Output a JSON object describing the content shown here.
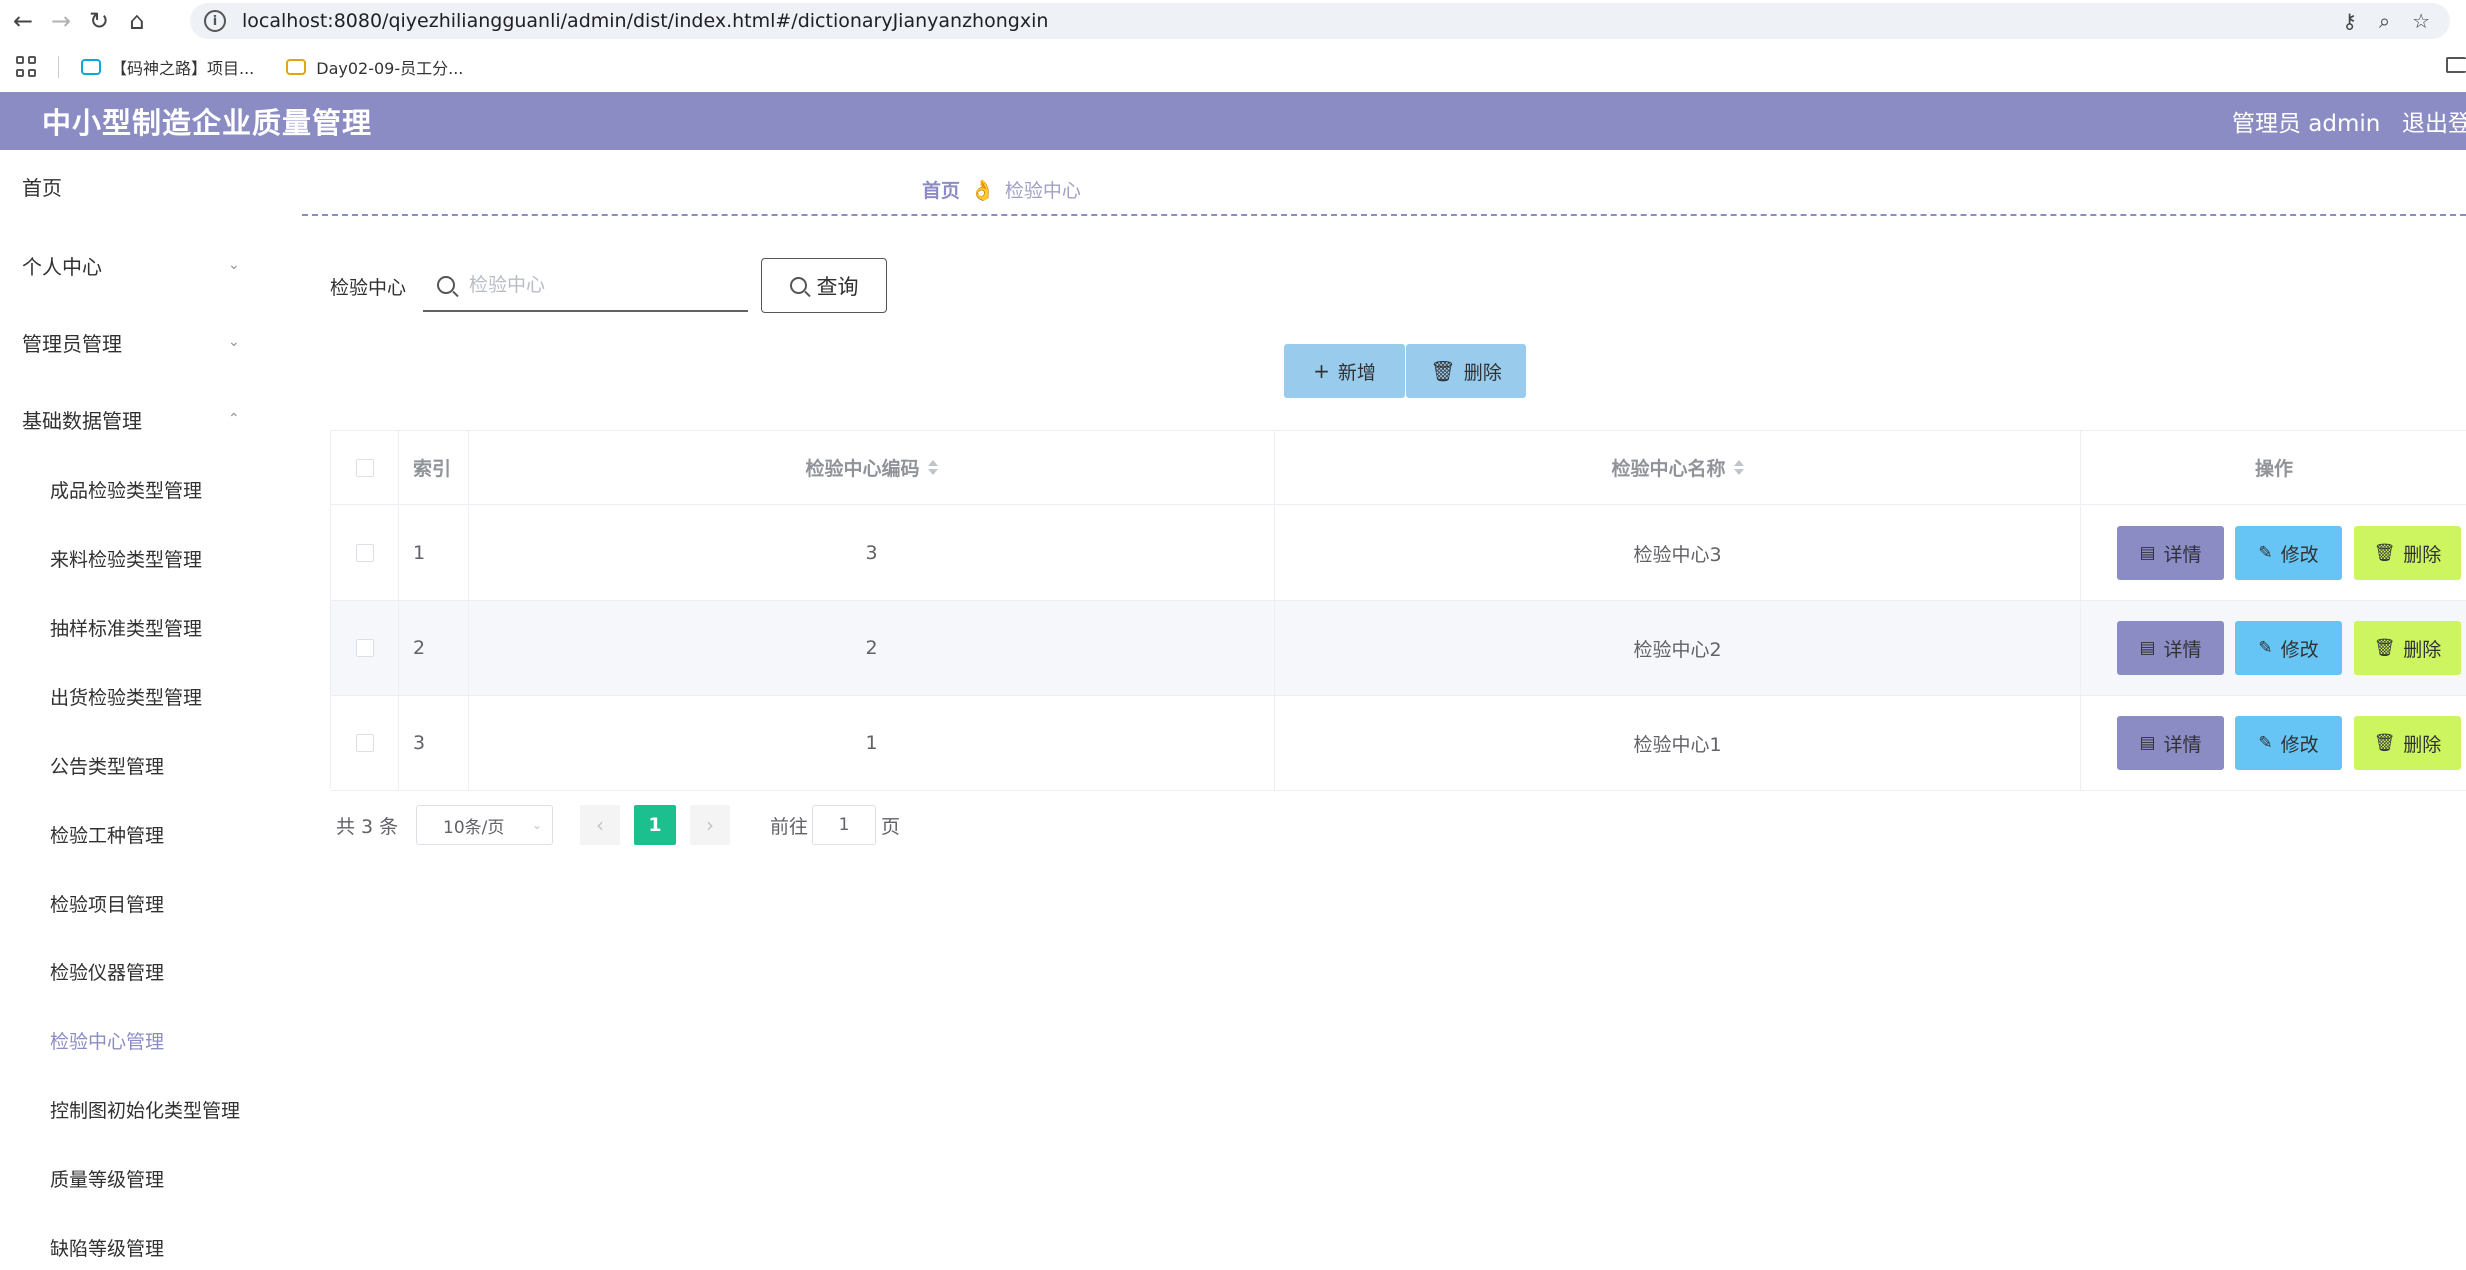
{
  "browser": {
    "url": "localhost:8080/qiyezhiliangguanli/admin/dist/index.html#/dictionaryJianyanzhongxin",
    "bookmarks": [
      {
        "label": "【码神之路】项目..."
      },
      {
        "label": "Day02-09-员工分..."
      }
    ]
  },
  "header": {
    "title": "中小型制造企业质量管理",
    "user": "管理员 admin",
    "logout": "退出登录"
  },
  "sidebar": {
    "items": [
      {
        "label": "首页"
      },
      {
        "label": "个人中心"
      },
      {
        "label": "管理员管理"
      },
      {
        "label": "基础数据管理"
      }
    ],
    "sub_items": [
      {
        "label": "成品检验类型管理"
      },
      {
        "label": "来料检验类型管理"
      },
      {
        "label": "抽样标准类型管理"
      },
      {
        "label": "出货检验类型管理"
      },
      {
        "label": "公告类型管理"
      },
      {
        "label": "检验工种管理"
      },
      {
        "label": "检验项目管理"
      },
      {
        "label": "检验仪器管理"
      },
      {
        "label": "检验中心管理"
      },
      {
        "label": "控制图初始化类型管理"
      },
      {
        "label": "质量等级管理"
      },
      {
        "label": "缺陷等级管理"
      }
    ]
  },
  "breadcrumb": {
    "home": "首页",
    "separator": "👌",
    "current": "检验中心"
  },
  "search": {
    "label": "检验中心",
    "placeholder": "检验中心",
    "value": "",
    "button": "查询"
  },
  "toolbar": {
    "add": "新增",
    "delete": "删除"
  },
  "table": {
    "headers": {
      "index": "索引",
      "code": "检验中心编码",
      "name": "检验中心名称",
      "actions": "操作"
    },
    "rows": [
      {
        "index": "1",
        "code": "3",
        "name": "检验中心3"
      },
      {
        "index": "2",
        "code": "2",
        "name": "检验中心2"
      },
      {
        "index": "3",
        "code": "1",
        "name": "检验中心1"
      }
    ],
    "row_actions": {
      "detail": "详情",
      "edit": "修改",
      "delete": "删除"
    }
  },
  "pagination": {
    "total": "共 3 条",
    "page_size": "10条/页",
    "current_page": "1",
    "goto_label": "前往",
    "goto_value": "1",
    "page_unit": "页"
  },
  "colors": {
    "brand": "#8c8cc5",
    "add_delete_btn": "#99ccec",
    "edit_btn": "#66c5f5",
    "delete_btn": "#ccf560",
    "pager_active": "#1cc08e"
  }
}
